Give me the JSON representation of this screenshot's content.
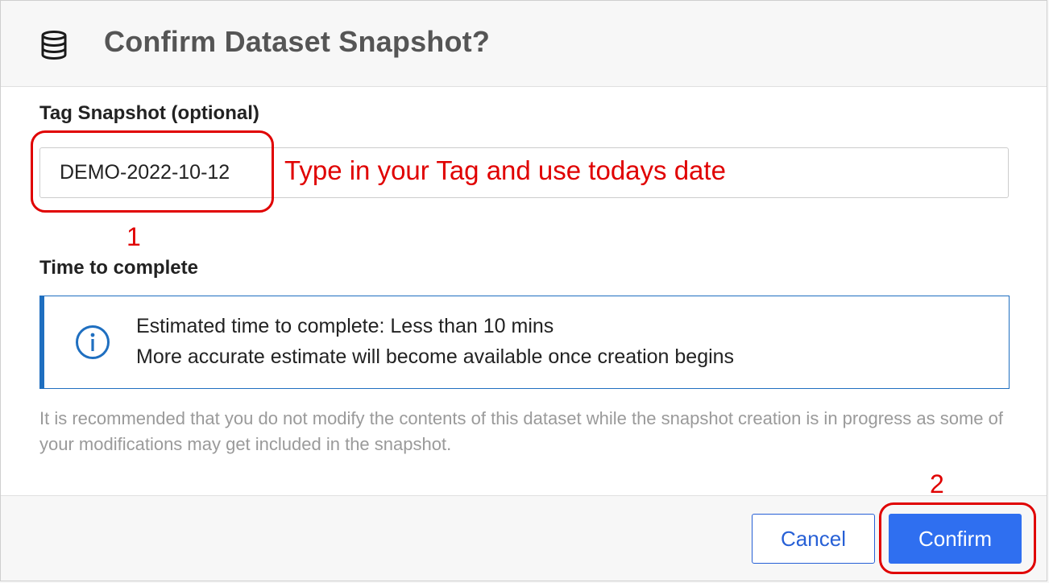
{
  "dialog": {
    "title": "Confirm Dataset Snapshot?",
    "header_icon": "database-icon"
  },
  "tag": {
    "label": "Tag Snapshot (optional)",
    "value": "DEMO-2022-10-12"
  },
  "time": {
    "label": "Time to complete",
    "info_icon": "info-icon",
    "line1": "Estimated time to complete: Less than 10 mins",
    "line2": "More accurate estimate will become available once creation begins"
  },
  "note": "It is recommended that you do not modify the contents of this dataset while the snapshot creation is in progress as some of your modifications may get included in the snapshot.",
  "buttons": {
    "cancel": "Cancel",
    "confirm": "Confirm"
  },
  "annotations": {
    "hint": "Type in your Tag and use todays date",
    "step1": "1",
    "step2": "2",
    "color": "#e00000"
  },
  "colors": {
    "primary": "#2f6ff0",
    "info_border": "#1f6fc0"
  }
}
